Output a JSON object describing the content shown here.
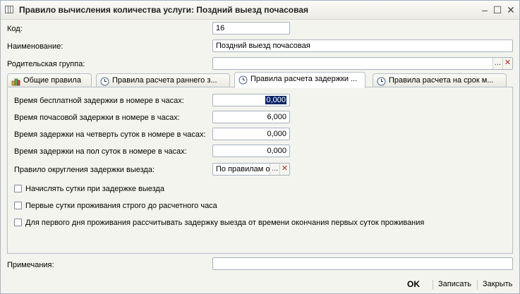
{
  "window": {
    "title": "Правило вычисления количества услуги: Поздний выезд почасовая",
    "minimize_glyph": "–",
    "maximize_glyph": "☐",
    "close_glyph": "✕"
  },
  "form": {
    "code_label": "Код:",
    "code_value": "16",
    "name_label": "Наименование:",
    "name_value": "Поздний выезд почасовая",
    "parent_label": "Родительская группа:",
    "parent_value": "",
    "ellipsis": "...",
    "clear_glyph": "✕"
  },
  "tabs": [
    {
      "label": "Общие правила",
      "icon": "rules-icon"
    },
    {
      "label": "Правила расчета раннего з...",
      "icon": "clock-icon"
    },
    {
      "label": "Правила расчета задержки ...",
      "icon": "clock-icon"
    },
    {
      "label": "Правила расчета на срок м...",
      "icon": "clock-icon"
    }
  ],
  "active_tab_index": 2,
  "delay_tab": {
    "free_delay_label": "Время бесплатной задержки в номере в часах:",
    "free_delay_value": "0,000",
    "hourly_delay_label": "Время почасовой задержки в номере в часах:",
    "hourly_delay_value": "6,000",
    "quarter_day_label": "Время задержки на четверть суток в номере в часах:",
    "quarter_day_value": "0,000",
    "half_day_label": "Время задержки на пол суток в номере в часах:",
    "half_day_value": "0,000",
    "rounding_label": "Правило округления задержки выезда:",
    "rounding_value": "По правилам о",
    "checkbox1": "Начислять сутки при задержке выезда",
    "checkbox2": "Первые сутки проживания строго до расчетного часа",
    "checkbox3": "Для первого дня проживания рассчитывать задержку выезда от времени окончания первых суток проживания"
  },
  "notes": {
    "label": "Примечания:",
    "value": ""
  },
  "buttons": {
    "ok": "OK",
    "save": "Записать",
    "close": "Закрыть"
  },
  "colors": {
    "selection_bg": "#0a246a",
    "clear_icon": "#b02a20"
  }
}
